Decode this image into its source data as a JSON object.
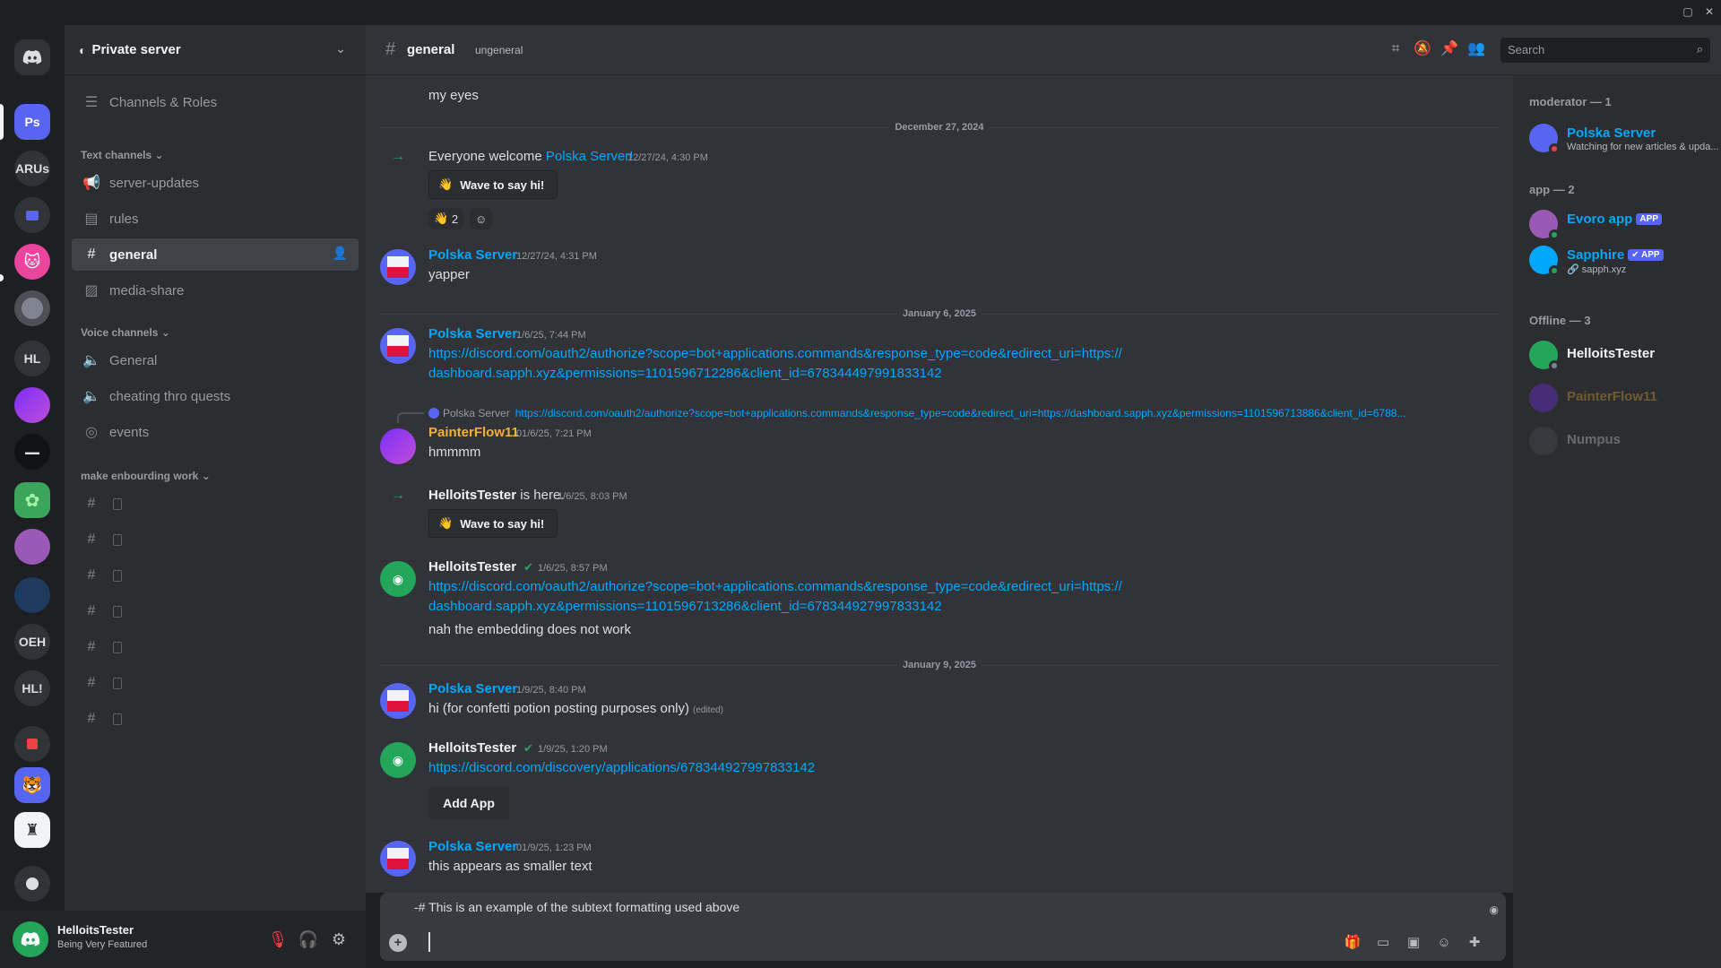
{
  "header": {
    "server_name": "Private server",
    "channel_name": "general",
    "channel_topic": "ungeneral",
    "search_placeholder": "Search"
  },
  "rail": {
    "servers": [
      {
        "label": "Ps"
      },
      {
        "label": "ARUs"
      },
      {
        "label": "HL"
      },
      {
        "label": "OEH"
      },
      {
        "label": "HL!"
      }
    ]
  },
  "sidebar": {
    "channels_roles": "Channels & Roles",
    "categories": {
      "text": "Text channels",
      "voice": "Voice channels",
      "onboarding": "make enbourding work"
    },
    "text_channels": [
      {
        "label": "server-updates"
      },
      {
        "label": "rules"
      },
      {
        "label": "general"
      },
      {
        "label": "media-share"
      }
    ],
    "voice_channels": [
      {
        "label": "General"
      },
      {
        "label": "cheating thro quests"
      },
      {
        "label": "events"
      }
    ],
    "onboarding_channel_count": 7
  },
  "user": {
    "name": "HelloitsTester",
    "status": "Being Very Featured"
  },
  "messages": {
    "top_text": "my eyes",
    "date1": "December 27, 2024",
    "join1": {
      "text": "Everyone welcome ",
      "name": "Polska Server!",
      "time": "12/27/24, 4:30 PM",
      "wave": "Wave to say hi!",
      "reaction_count": "2"
    },
    "m1": {
      "author": "Polska Server",
      "time": "12/27/24, 4:31 PM",
      "text": "yapper"
    },
    "date2": "January 6, 2025",
    "m2": {
      "author": "Polska Server",
      "time": "1/6/25, 7:44 PM",
      "link1": "https://discord.com/oauth2/authorize?scope=bot+applications.commands&response_type=code&redirect_uri=https://",
      "link2": "dashboard.sapph.xyz&permissions=1101596712286&client_id=678344497991833142"
    },
    "m3": {
      "reply_name": "Polska Server",
      "reply_link": "https://discord.com/oauth2/authorize?scope=bot+applications.commands&response_type=code&redirect_uri=https://dashboard.sapph.xyz&permissions=1101596713886&client_id=6788...",
      "author": "PainterFlow11",
      "time": "01/6/25, 7:21 PM",
      "text": "hmmmm"
    },
    "join2": {
      "name": "HelloitsTester",
      "text": " is here.",
      "time": "1/6/25, 8:03 PM",
      "wave": "Wave to say hi!"
    },
    "m4": {
      "author": "HelloitsTester",
      "time": "1/6/25, 8:57 PM",
      "link1": "https://discord.com/oauth2/authorize?scope=bot+applications.commands&response_type=code&redirect_uri=https://",
      "link2": "dashboard.sapph.xyz&permissions=1101596713286&client_id=678344927997833142",
      "text": "nah the embedding does not work"
    },
    "date3": "January 9, 2025",
    "m5": {
      "author": "Polska Server",
      "time": "1/9/25, 8:40 PM",
      "text": "hi (for confetti potion posting purposes only)",
      "edited": "(edited)"
    },
    "m6": {
      "author": "HelloitsTester",
      "time": "1/9/25, 1:20 PM",
      "link": "https://discord.com/discovery/applications/678344927997833142",
      "button": "Add App"
    },
    "m7": {
      "author": "Polska Server",
      "time": "01/9/25, 1:23 PM",
      "text": "this appears as smaller text"
    }
  },
  "composer": {
    "subtext": "-# This is an example of the subtext formatting used above"
  },
  "members": {
    "cat_moderator": "moderator — 1",
    "cat_app": "app — 2",
    "cat_offline": "Offline — 3",
    "mod1": {
      "name": "Polska Server",
      "sub": "Watching for new articles & upda..."
    },
    "app1": {
      "name": "Evoro app",
      "badge": "APP"
    },
    "app2": {
      "name": "Sapphire",
      "badge": "✔ APP",
      "sub": "sapph.xyz"
    },
    "off1": {
      "name": "HelloitsTester"
    },
    "off2": {
      "name": "PainterFlow11"
    },
    "off3": {
      "name": "Numpus"
    }
  },
  "colors": {
    "background": "#313338",
    "sidebar": "#2b2d31",
    "rail": "#1e1f22",
    "link": "#00a8fc",
    "online": "#23a55a",
    "brand": "#5865f2"
  }
}
